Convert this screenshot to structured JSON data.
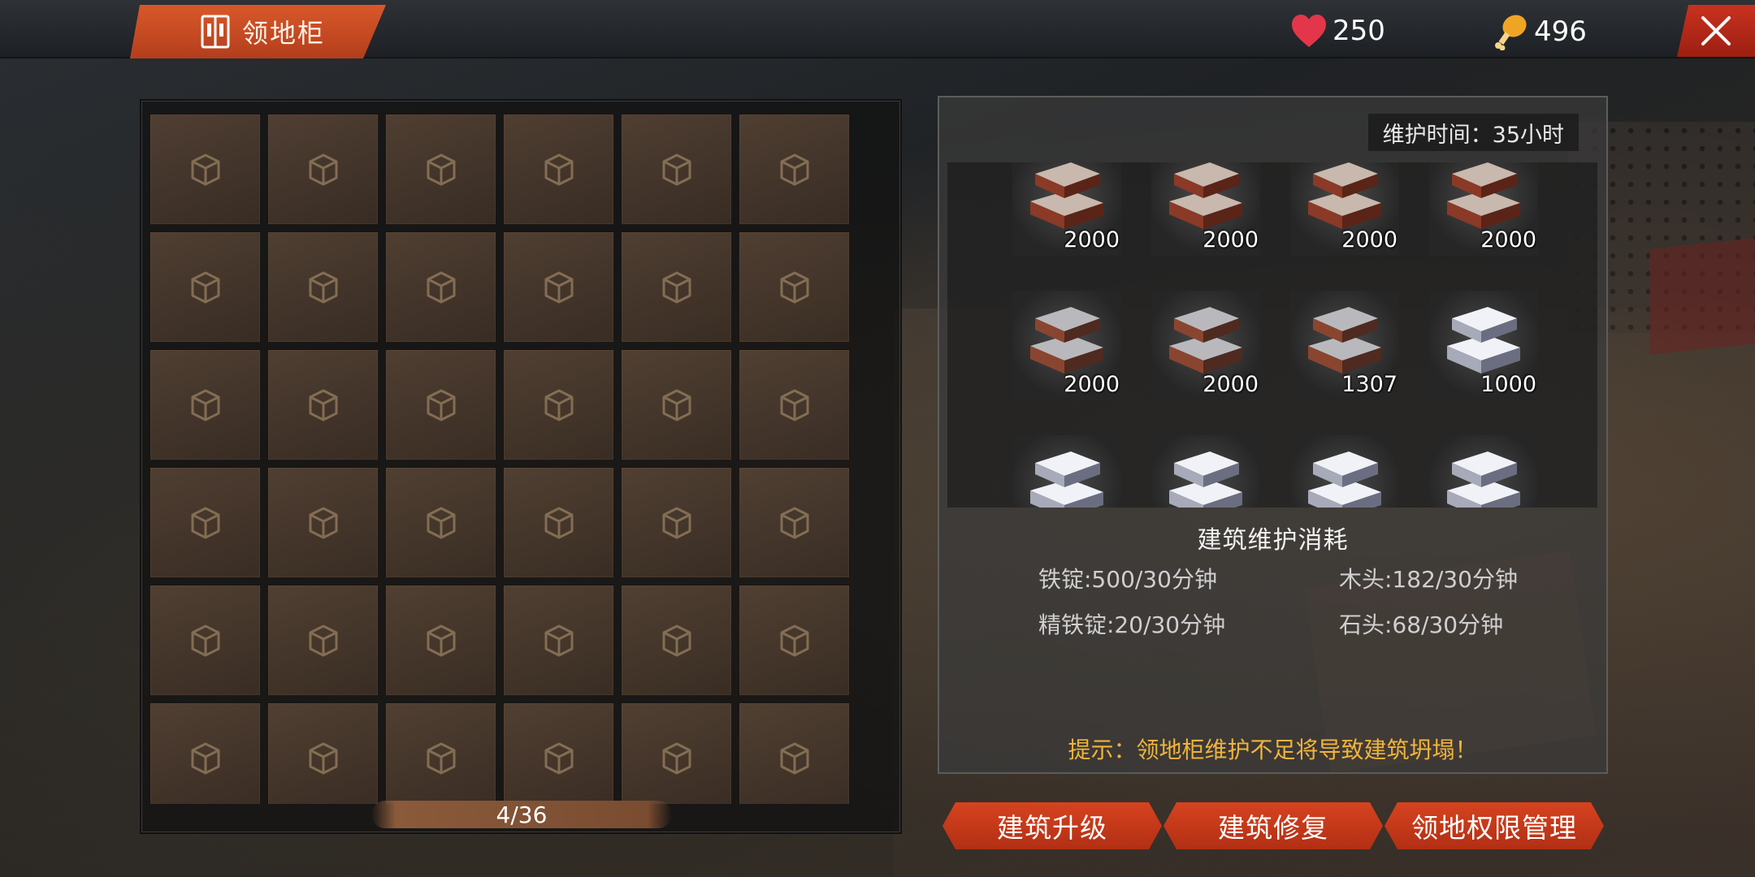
{
  "header": {
    "title": "领地柜",
    "health": "250",
    "food": "496",
    "colors": {
      "accent": "#c9441d",
      "close": "#b32616"
    }
  },
  "storage": {
    "capacity": "4/36",
    "slot_icon": "box-icon"
  },
  "maintenance": {
    "time_label": "维护时间：35小时",
    "items": [
      {
        "type": "copper-ingot",
        "qty": "2000"
      },
      {
        "type": "copper-ingot",
        "qty": "2000"
      },
      {
        "type": "copper-ingot",
        "qty": "2000"
      },
      {
        "type": "copper-ingot",
        "qty": "2000"
      },
      {
        "type": "iron-ingot",
        "qty": "2000"
      },
      {
        "type": "iron-ingot",
        "qty": "2000"
      },
      {
        "type": "iron-ingot",
        "qty": "1307"
      },
      {
        "type": "silver-ingot",
        "qty": "1000"
      },
      {
        "type": "silver-ingot",
        "qty": ""
      },
      {
        "type": "silver-ingot",
        "qty": ""
      },
      {
        "type": "silver-ingot",
        "qty": ""
      },
      {
        "type": "silver-ingot",
        "qty": ""
      }
    ],
    "consumption_title": "建筑维护消耗",
    "costs": {
      "iron_ingot": "铁锭:500/30分钟",
      "wood": "木头:182/30分钟",
      "refined_iron": "精铁锭:20/30分钟",
      "stone": "石头:68/30分钟"
    },
    "hint": "提示：领地柜维护不足将导致建筑坍塌！"
  },
  "actions": {
    "upgrade": "建筑升级",
    "repair": "建筑修复",
    "permissions": "领地权限管理"
  }
}
